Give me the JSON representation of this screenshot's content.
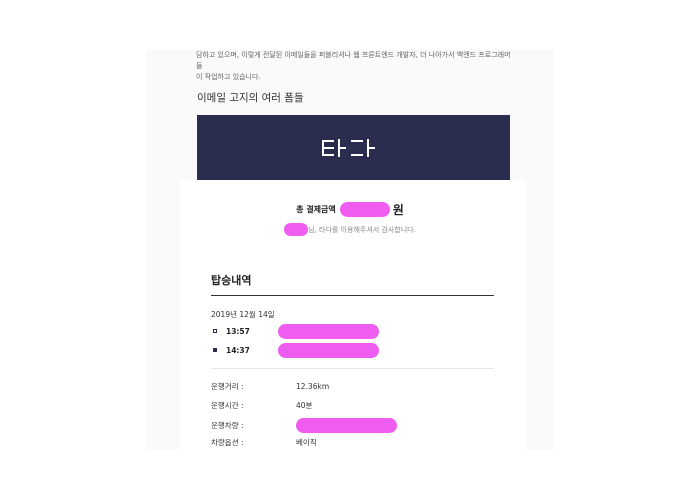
{
  "intro": {
    "line1": "담하고 있으며, 이렇게 전달된 이메일들을 퍼블리셔나 웹 프론트엔드 개발자, 더 나아가서 백엔드 프로그래머들",
    "line2": "이 작업하고 있습니다."
  },
  "section_heading": "이메일 고지의 여러 폼들",
  "banner": {
    "brand": "타다",
    "color": "#2b2d4f"
  },
  "receipt": {
    "total_label": "총 결제금액",
    "total_unit": "원",
    "thanks_text": "님, 타다를 이용해주셔서 감사합니다.",
    "redaction_color": "#ef5cf0"
  },
  "rides": {
    "title": "탑승내역",
    "date": "2019년 12월 14일",
    "depart_time": "13:57",
    "arrive_time": "14:37"
  },
  "details": {
    "distance_label": "운행거리 :",
    "distance_value": "12.36km",
    "duration_label": "운행시간 :",
    "duration_value": "40분",
    "vehicle_label": "운행차량 :",
    "option_label": "차량옵션 :",
    "option_value": "베이직"
  }
}
